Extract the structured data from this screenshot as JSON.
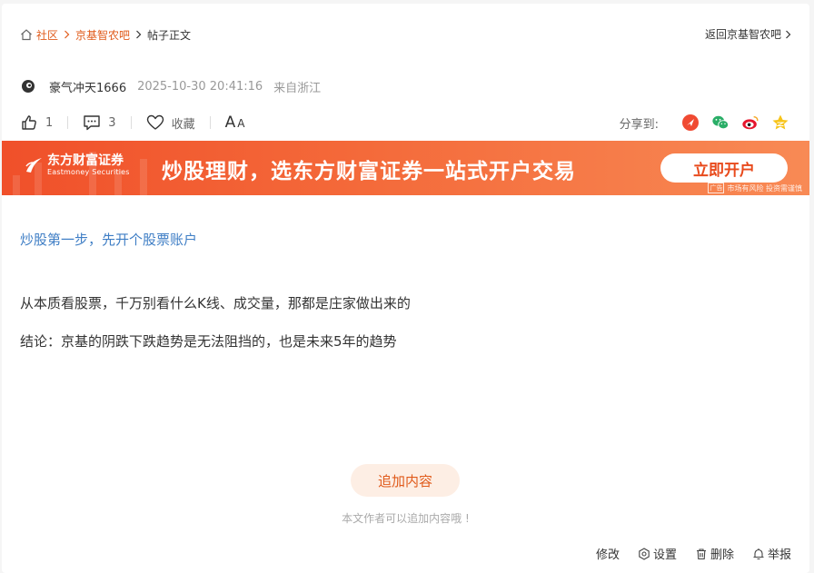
{
  "breadcrumb": {
    "home": "社区",
    "forum": "京基智农吧",
    "current": "帖子正文"
  },
  "back_link": "返回京基智农吧",
  "author": {
    "name": "豪气冲天1666",
    "time": "2025-10-30 20:41:16",
    "location": "来自浙江"
  },
  "actions": {
    "like_count": "1",
    "comment_count": "3",
    "favorite_label": "收藏",
    "font_big": "A",
    "font_small": "A"
  },
  "share": {
    "label": "分享到:",
    "icons": [
      "toutiao-icon",
      "wechat-icon",
      "weibo-icon",
      "qzone-icon"
    ]
  },
  "banner": {
    "brand_cn": "东方财富证券",
    "brand_en": "Eastmoney Securities",
    "slogan": "炒股理财，选东方财富证券一站式开户交易",
    "button": "立即开户",
    "ad_tag": "广告",
    "ad_disclaimer": "市场有风险 投资需谨慎"
  },
  "content": {
    "promo_link": "炒股第一步，先开个股票账户",
    "paragraphs": [
      "从本质看股票，千万别看什么K线、成交量，那都是庄家做出来的",
      "结论：京基的阴跌下跌趋势是无法阻挡的，也是未来5年的趋势"
    ]
  },
  "add_content": {
    "button": "追加内容",
    "hint": "本文作者可以追加内容哦 !"
  },
  "footer": {
    "edit": "修改",
    "settings": "设置",
    "delete": "删除",
    "report": "举报"
  },
  "colors": {
    "accent": "#e05a1a",
    "link": "#3f7ec5",
    "banner_start": "#f0502a",
    "banner_end": "#f88a55"
  }
}
